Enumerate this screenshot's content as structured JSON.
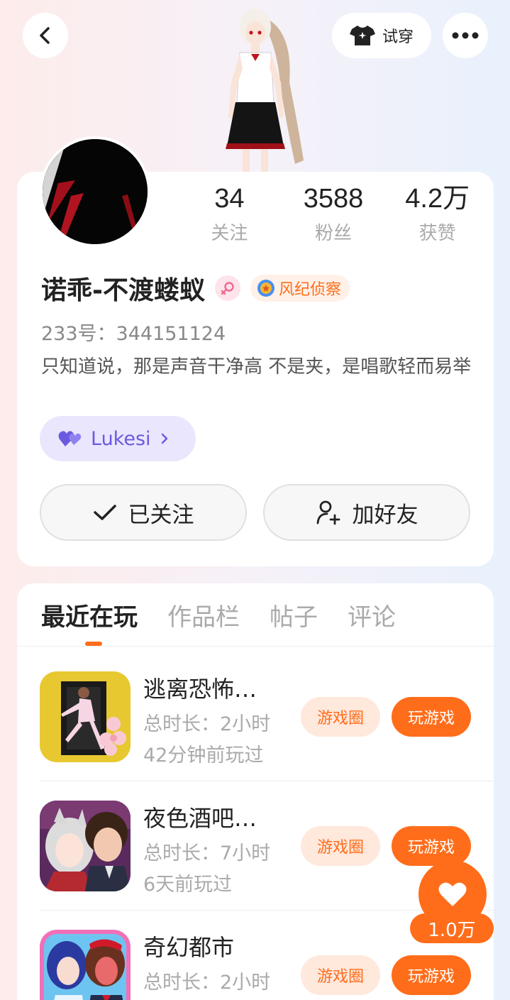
{
  "header": {
    "try_on_label": "试穿"
  },
  "profile": {
    "stats": [
      {
        "value": "34",
        "label": "关注"
      },
      {
        "value": "3588",
        "label": "粉丝"
      },
      {
        "value": "4.2万",
        "label": "获赞"
      }
    ],
    "name": "诺乖-不渡蝼蚁",
    "badge": "风纪侦察",
    "uid": "233号：344151124",
    "bio": "只知道说，那是声音干净高 不是夹，是唱歌轻而易举",
    "club": "Lukesi",
    "follow_label": "已关注",
    "add_friend_label": "加好友"
  },
  "tabs": [
    "最近在玩",
    "作品栏",
    "帖子",
    "评论"
  ],
  "games": [
    {
      "title": "逃离恐怖…",
      "duration": "总时长：2小时",
      "last_played": "42分钟前玩过",
      "circle_label": "游戏圈",
      "play_label": "玩游戏"
    },
    {
      "title": "夜色酒吧…",
      "duration": "总时长：7小时",
      "last_played": "6天前玩过",
      "circle_label": "游戏圈",
      "play_label": "玩游戏"
    },
    {
      "title": "奇幻都市",
      "duration": "总时长：2小时",
      "last_played": "",
      "circle_label": "游戏圈",
      "play_label": "玩游戏"
    }
  ],
  "like": {
    "count": "1.0万"
  },
  "colors": {
    "accent": "#ff6d1a",
    "club": "#6a5ae0"
  }
}
